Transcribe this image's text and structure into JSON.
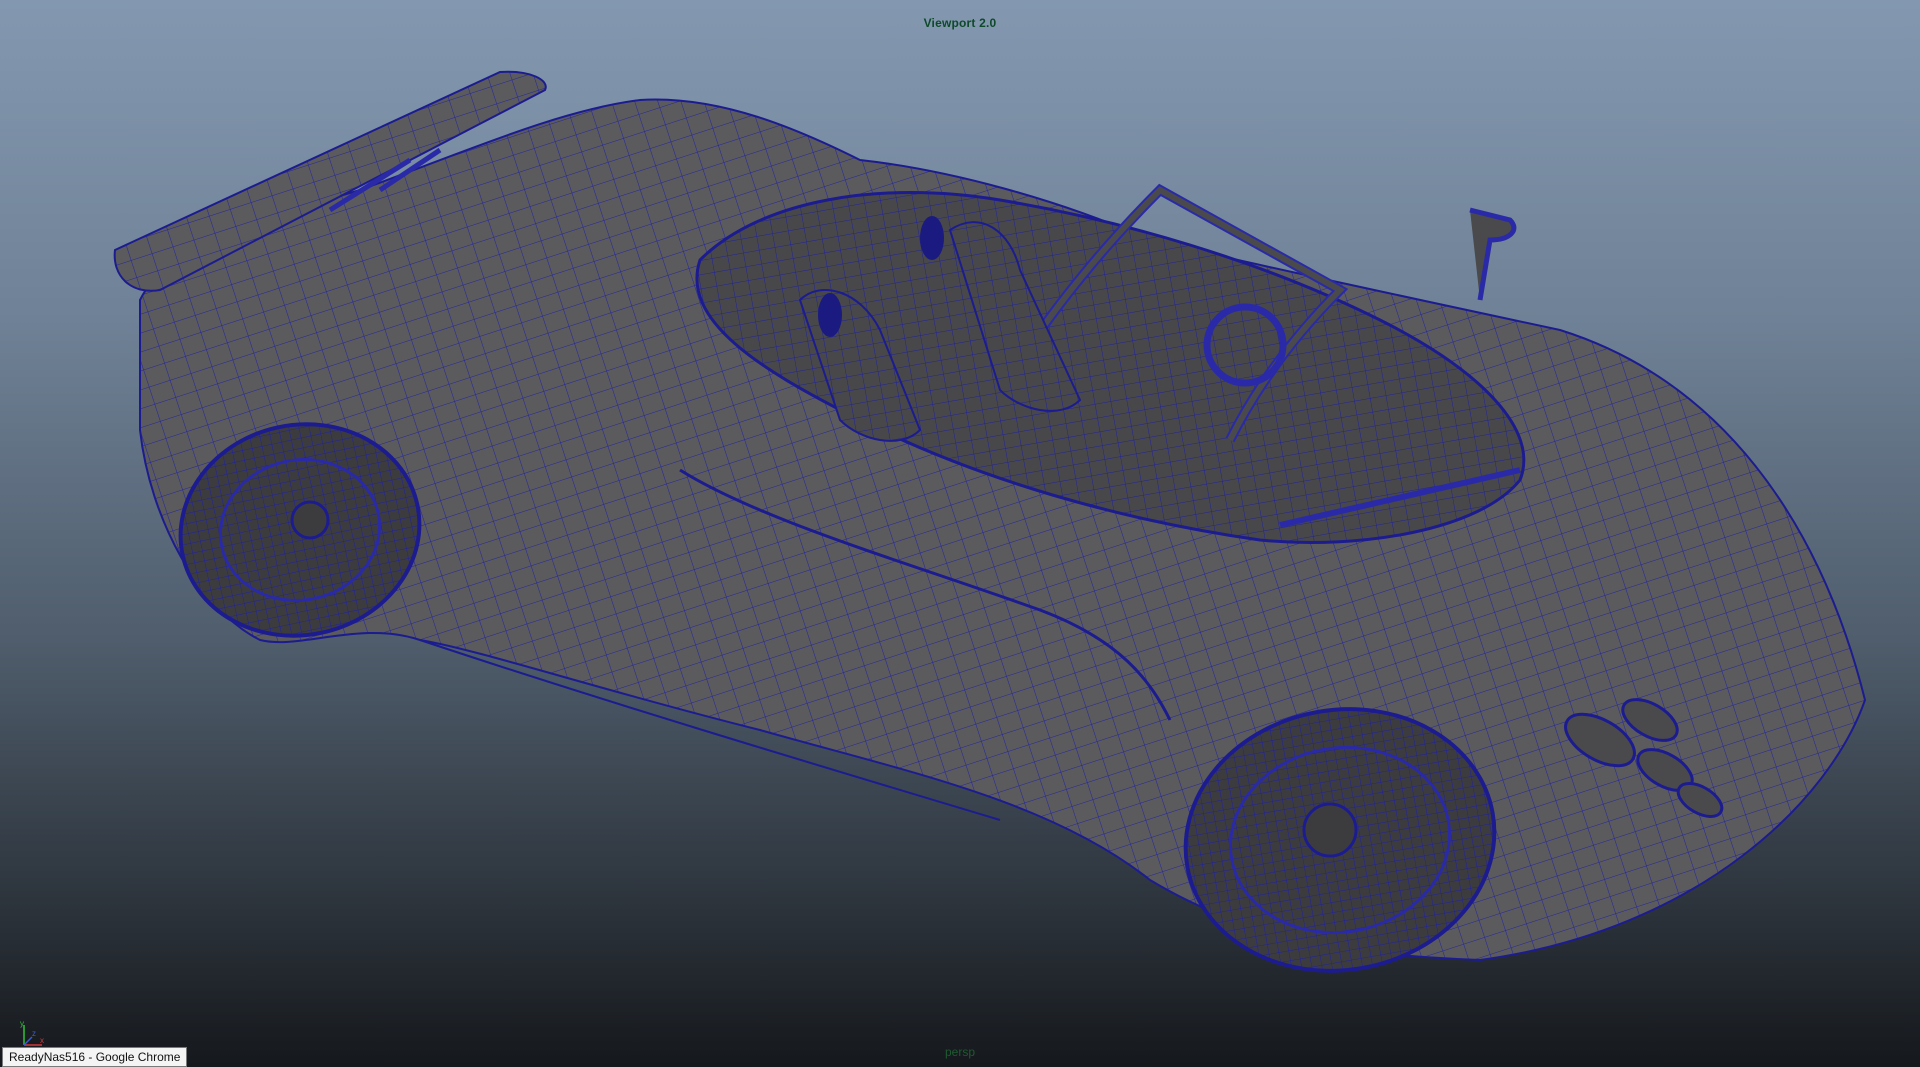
{
  "viewport": {
    "renderer_label": "Viewport 2.0",
    "camera_label": "persp",
    "background_top": "#8398b0",
    "background_bottom": "#15181c",
    "wire_color": "#1f1fa8",
    "shade_color": "#5a5a5a"
  },
  "scene": {
    "object_icon": "sports-car-wireframe-model"
  },
  "axis_gizmo": {
    "icon": "xyz-axis-gizmo-icon",
    "y_label": "y",
    "x_label": "x",
    "z_label": "z"
  },
  "taskbar_tooltip": {
    "text": "ReadyNas516 - Google Chrome"
  }
}
